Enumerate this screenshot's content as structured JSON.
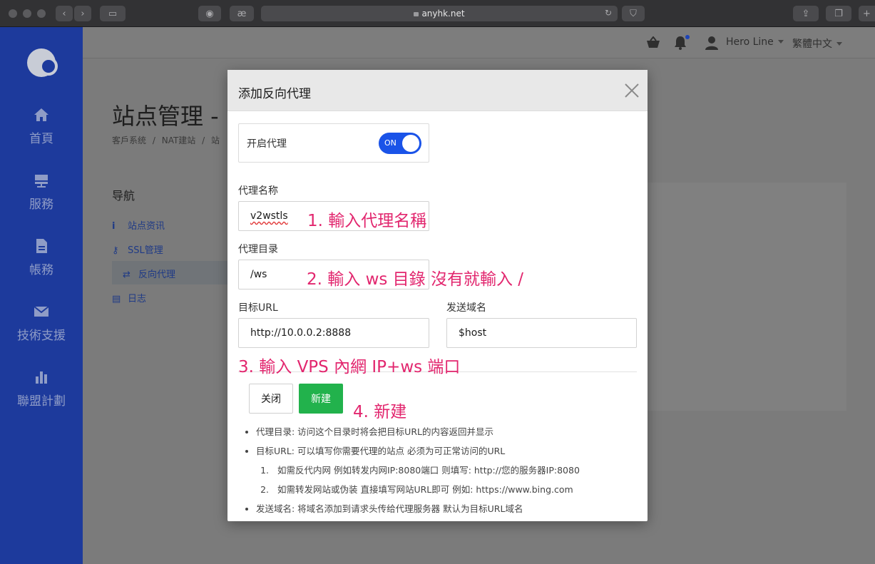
{
  "browser": {
    "url": "anyhk.net"
  },
  "sidebar": {
    "items": [
      {
        "label": "首頁",
        "icon": "home-icon"
      },
      {
        "label": "服務",
        "icon": "server-icon"
      },
      {
        "label": "帳務",
        "icon": "document-icon"
      },
      {
        "label": "技術支援",
        "icon": "mail-icon"
      },
      {
        "label": "聯盟計劃",
        "icon": "bar-chart-icon"
      }
    ]
  },
  "topbar": {
    "user": "Hero Line",
    "language": "繁體中文"
  },
  "page": {
    "title": "站点管理 -",
    "breadcrumb": [
      "客戶系统",
      "NAT建站",
      "站"
    ],
    "nav_title": "导航",
    "nav_items": [
      "站点资讯",
      "SSL管理",
      "反向代理",
      "日志"
    ]
  },
  "modal": {
    "title": "添加反向代理",
    "toggle_label": "开启代理",
    "toggle_state": "ON",
    "proxy_name_label": "代理名称",
    "proxy_name_value": "v2wstls",
    "proxy_dir_label": "代理目录",
    "proxy_dir_value": "/ws",
    "target_url_label": "目标URL",
    "target_url_value": "http://10.0.0.2:8888",
    "send_domain_label": "发送域名",
    "send_domain_value": "$host",
    "close_label": "关闭",
    "create_label": "新建",
    "notes": {
      "item1": "代理目录: 访问这个目录时将会把目标URL的内容返回并显示",
      "item2": "目标URL: 可以填写你需要代理的站点 必须为可正常访问的URL",
      "sub1": "如需反代内网 例如转发内网IP:8080端口 则填写: http://您的服务器IP:8080",
      "sub2": "如需转发网站或伪装 直接填写网站URL即可 例如: https://www.bing.com",
      "item3": "发送域名: 将域名添加到请求头传给代理服务器 默认为目标URL域名"
    }
  },
  "annotations": {
    "a1": "1. 輸入代理名稱",
    "a2": "2. 輸入 ws 目錄 沒有就輸入 /",
    "a3": "3. 輸入 VPS 內網 IP+ws 端口",
    "a4": "4. 新建"
  },
  "colors": {
    "sidebar": "#1d3a9c",
    "toggle_on": "#1a53e8",
    "create_button": "#22b24c",
    "annotation": "#e2266e"
  }
}
